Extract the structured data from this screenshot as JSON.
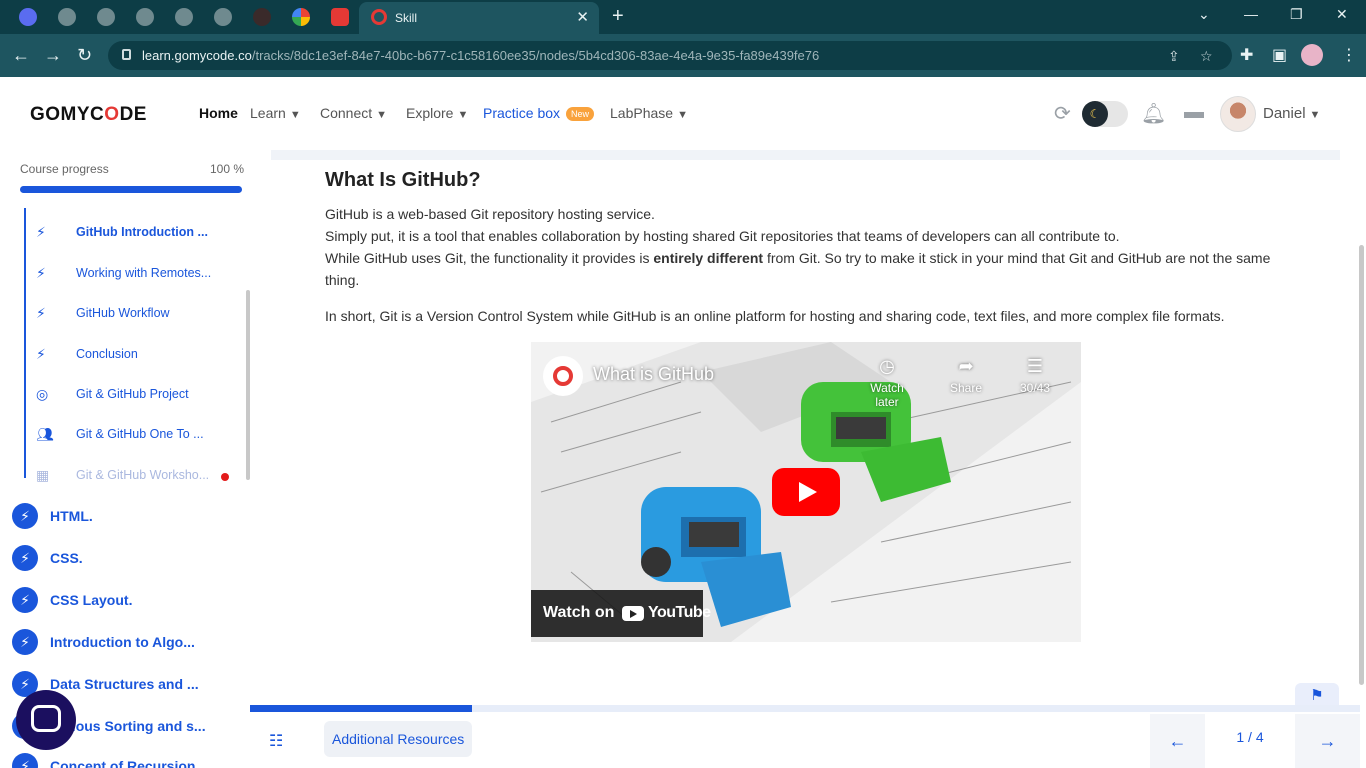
{
  "browser": {
    "active_tab_title": "Skill",
    "url_host": "learn.gomycode.co",
    "url_path": "/tracks/8dc1e3ef-84e7-40bc-b677-c1c58160ee35/nodes/5b4cd306-83ae-4e4a-9e35-fa89e439fe76"
  },
  "header": {
    "logo": "GOMYCODE",
    "nav": {
      "home": "Home",
      "learn": "Learn",
      "connect": "Connect",
      "explore": "Explore",
      "practice": "Practice box",
      "practice_badge": "New",
      "labphase": "LabPhase"
    },
    "user_name": "Daniel"
  },
  "sidebar": {
    "progress_label": "Course progress",
    "progress_pct_label": "100 %",
    "progress_value": 1.0,
    "sub_items": [
      {
        "label": "GitHub Introduction ...",
        "icon": "bolt-icon"
      },
      {
        "label": "Working with Remotes...",
        "icon": "bolt-icon"
      },
      {
        "label": "GitHub Workflow",
        "icon": "bolt-icon"
      },
      {
        "label": "Conclusion",
        "icon": "bolt-icon"
      },
      {
        "label": "Git & GitHub Project",
        "icon": "target-icon"
      },
      {
        "label": "Git & GitHub One To ...",
        "icon": "people-icon"
      },
      {
        "label": "Git & GitHub Worksho...",
        "icon": "workshop-icon"
      }
    ],
    "modules": [
      {
        "label": "HTML."
      },
      {
        "label": "CSS."
      },
      {
        "label": "CSS Layout."
      },
      {
        "label": "Introduction to Algo..."
      },
      {
        "label": "Data Structures and ..."
      },
      {
        "label": "Various Sorting and s..."
      },
      {
        "label": "Concept of Recursion"
      }
    ]
  },
  "content": {
    "title": "What Is GitHub?",
    "p1": "GitHub is a web-based Git repository hosting service.",
    "p2": "Simply put, it is a tool that enables collaboration by hosting shared Git repositories that teams of developers can all contribute to.",
    "p3_before": "While GitHub uses Git, the functionality it provides is ",
    "p3_bold": "entirely different",
    "p3_after": " from Git. So try to make it stick in your mind that Git and GitHub are not the same thing.",
    "p4": "In short, Git is a Version Control System while GitHub is an online platform for hosting and sharing code, text files, and more complex file formats.",
    "video": {
      "title": "What is GitHub",
      "watch_later": "Watch later",
      "share": "Share",
      "playlist_count": "30/43",
      "watch_on": "Watch on",
      "youtube": "YouTube"
    }
  },
  "footer": {
    "resources_label": "Additional Resources",
    "page_indicator": "1 / 4",
    "progress_value": 0.2
  },
  "colors": {
    "accent": "#1a56db",
    "browser_dark": "#0d3d46",
    "browser_bar": "#1e5560",
    "chat": "#1b0f5f"
  }
}
